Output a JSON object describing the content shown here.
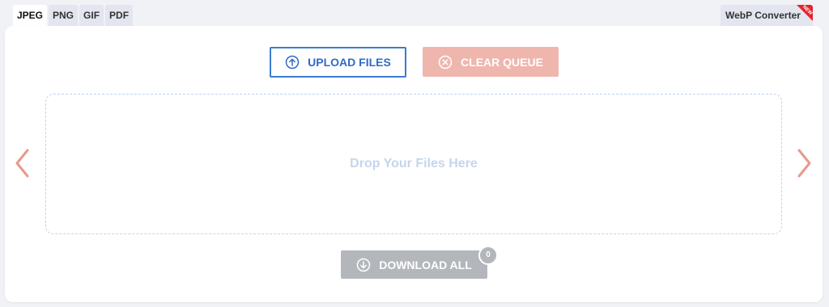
{
  "tabs": [
    {
      "label": "JPEG",
      "active": true
    },
    {
      "label": "PNG",
      "active": false
    },
    {
      "label": "GIF",
      "active": false
    },
    {
      "label": "PDF",
      "active": false
    }
  ],
  "webp_tab": {
    "label": "WebP Converter",
    "badge": "NEW"
  },
  "buttons": {
    "upload": "UPLOAD FILES",
    "clear": "CLEAR QUEUE",
    "download": "DOWNLOAD ALL"
  },
  "dropzone": {
    "text": "Drop Your Files Here"
  },
  "download_count": "0",
  "icons": {
    "upload": "arrow-up-circle-icon",
    "clear": "x-circle-icon",
    "download": "arrow-down-circle-icon",
    "prev": "chevron-left-icon",
    "next": "chevron-right-icon"
  },
  "colors": {
    "primary": "#2f6cc4",
    "clear": "#efb6ad",
    "download": "#b3b6bb",
    "arrow": "#e89a8a",
    "new_badge": "#e5232b"
  }
}
